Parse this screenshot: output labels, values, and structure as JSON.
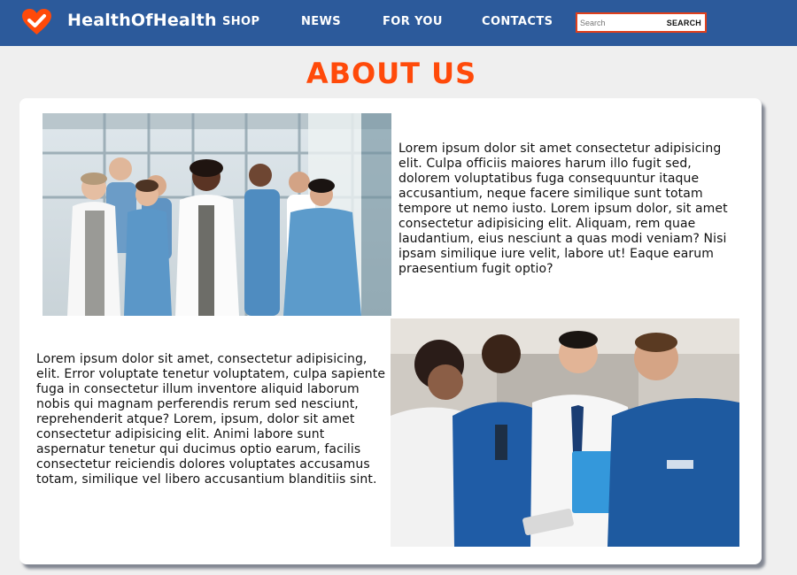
{
  "brand": {
    "name": "HealthOfHealth",
    "logo_icon": "heart-check-icon",
    "logo_color": "#ff4a0a"
  },
  "nav": {
    "links": [
      "SHOP",
      "NEWS",
      "FOR YOU",
      "CONTACTS"
    ],
    "background": "#2c5a9b"
  },
  "search": {
    "placeholder": "Search",
    "value": "",
    "button_label": "SEARCH",
    "border_color": "#e0401c"
  },
  "main": {
    "title": "ABOUT US",
    "title_color": "#ff4a0a",
    "paragraph_1": "Lorem ipsum dolor sit amet consectetur adipisicing elit. Culpa officiis maiores harum illo fugit sed, dolorem voluptatibus fuga consequuntur itaque accusantium, neque facere similique sunt totam tempore ut nemo iusto. Lorem ipsum dolor, sit amet consectetur adipisicing elit. Aliquam, rem quae laudantium, eius nesciunt a quas modi veniam? Nisi ipsam similique iure velit, labore ut! Eaque earum praesentium fugit optio?",
    "paragraph_2": "Lorem ipsum dolor sit amet, consectetur adipisicing, elit. Error voluptate tenetur voluptatem, culpa sapiente fuga in consectetur illum inventore aliquid laborum nobis qui magnam perferendis rerum sed nesciunt, reprehenderit atque? Lorem, ipsum, dolor sit amet consectetur adipisicing elit. Animi labore sunt aspernatur tenetur qui ducimus optio earum, facilis consectetur reiciendis dolores voluptates accusamus totam, similique vel libero accusantium blanditiis sint.",
    "images": [
      {
        "name": "medical-team-photo"
      },
      {
        "name": "doctors-tablet-photo"
      }
    ]
  }
}
